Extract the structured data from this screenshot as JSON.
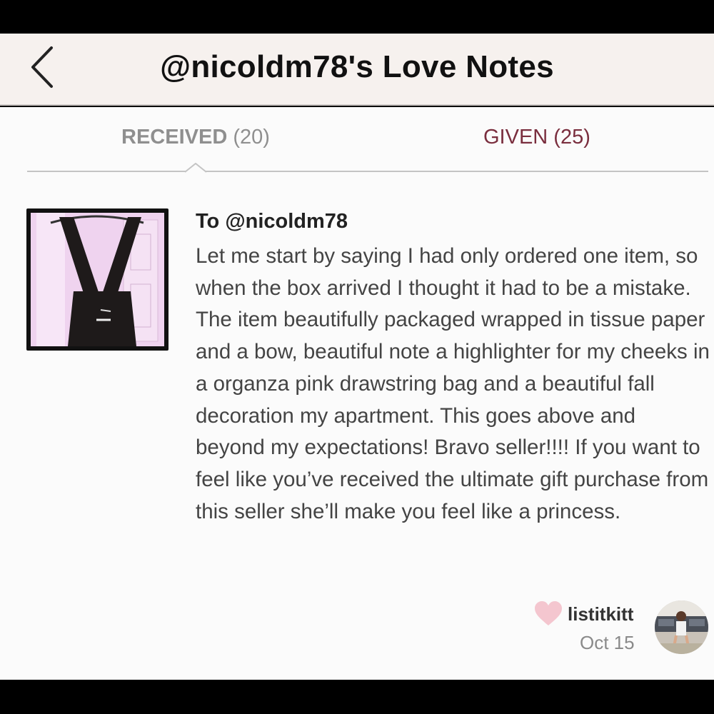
{
  "header": {
    "title": "@nicoldm78's Love Notes",
    "back_icon": "chevron-left-icon"
  },
  "tabs": {
    "received": {
      "label": "RECEIVED",
      "count": "(20)",
      "active": true
    },
    "given": {
      "label": "GIVEN (25)",
      "active": false
    }
  },
  "note": {
    "recipient": "To @nicoldm78",
    "body": "Let me start by saying I had only ordered one item, so when the box arrived I thought it had to be a mistake. The item beautifully packaged wrapped in tissue paper and a bow, beautiful note a highlighter for my cheeks in a organza pink drawstring bag and a beautiful fall decoration my apartment. This goes above and beyond my expectations! Bravo seller!!!! If you want to feel like you’ve received the ultimate gift purchase from this seller she’ll make you feel like a princess.",
    "author": "listitkitt",
    "date": "Oct 15",
    "heart_icon": "heart-icon",
    "heart_color": "#f4c6cf"
  },
  "colors": {
    "header_bg": "#f6f1ee",
    "active_tab": "#8f8f8f",
    "given_tab": "#7a2e3e"
  }
}
